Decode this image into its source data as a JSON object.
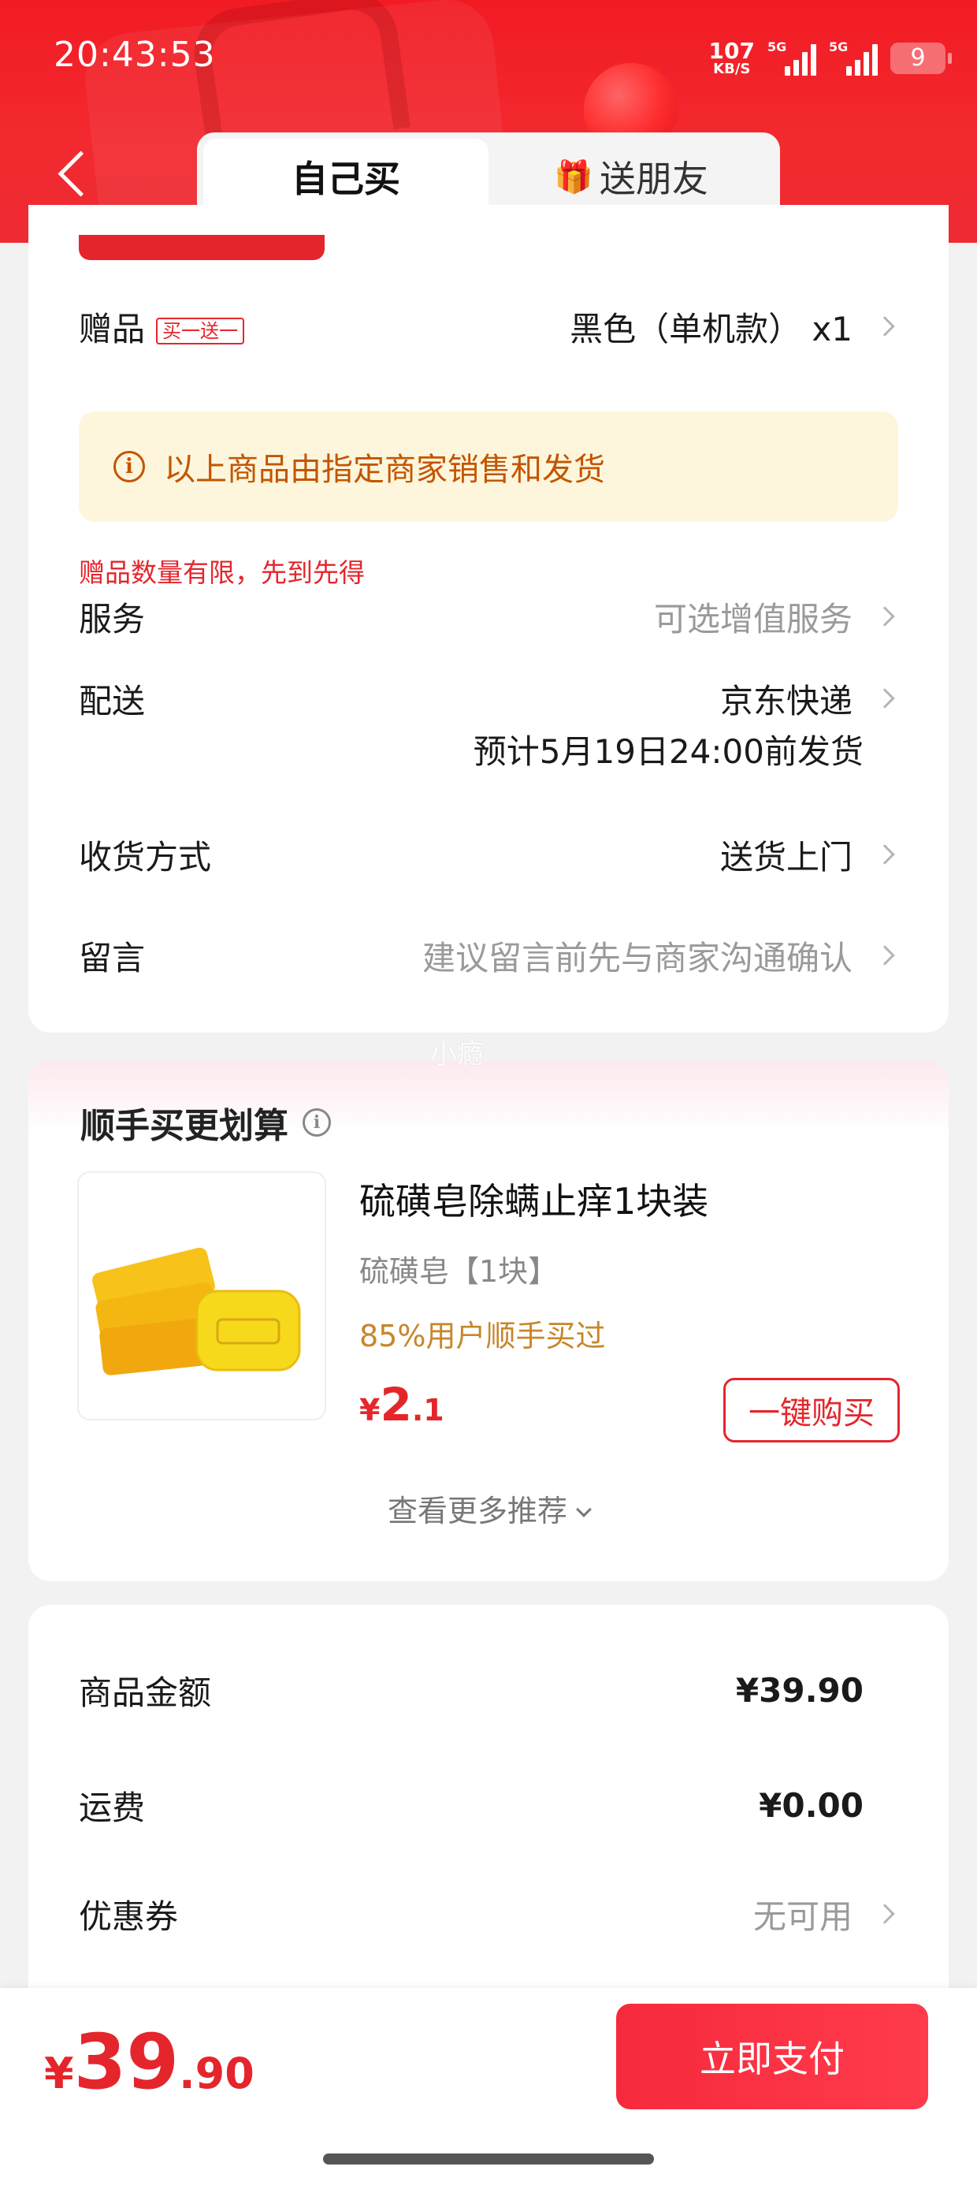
{
  "status_bar": {
    "time": "20:43:53",
    "net_speed_value": "107",
    "net_speed_unit": "KB/S",
    "signal1_tag": "5G",
    "signal2_tag": "5G",
    "battery": "9"
  },
  "header": {
    "tabs": [
      {
        "label": "自己买",
        "active": true
      },
      {
        "label": "送朋友",
        "active": false
      }
    ]
  },
  "order": {
    "gift": {
      "label": "赠品",
      "badge": "买一送一",
      "value": "黑色（单机款） x1"
    },
    "notice": "以上商品由指定商家销售和发货",
    "limit_note": "赠品数量有限，先到先得",
    "service": {
      "label": "服务",
      "value": "可选增值服务"
    },
    "delivery": {
      "label": "配送",
      "value": "京东快递",
      "eta": "预计5月19日24:00前发货"
    },
    "receive": {
      "label": "收货方式",
      "value": "送货上门"
    },
    "message": {
      "label": "留言",
      "placeholder": "建议留言前先与商家沟通确认"
    }
  },
  "watermark": "小瘾",
  "recommend": {
    "title": "顺手买更划算",
    "product": {
      "name": "硫磺皂除螨止痒1块装",
      "spec": "硫磺皂【1块】",
      "users": "85%用户顺手买过",
      "price_currency": "¥",
      "price_int": "2",
      "price_dec": ".1",
      "buy_label": "一键购买"
    },
    "more_label": "查看更多推荐"
  },
  "amounts": {
    "goods": {
      "label": "商品金额",
      "value": "¥39.90"
    },
    "shipping": {
      "label": "运费",
      "value": "¥0.00"
    },
    "coupon": {
      "label": "优惠券",
      "value": "无可用"
    }
  },
  "bottom": {
    "total_currency": "¥",
    "total_int": "39",
    "total_dec": ".90",
    "pay_label": "立即支付"
  },
  "colors": {
    "brand_red": "#e4262c",
    "notice_bg": "#fdf6dc",
    "notice_text": "#c35500",
    "users_text": "#c8862a"
  }
}
